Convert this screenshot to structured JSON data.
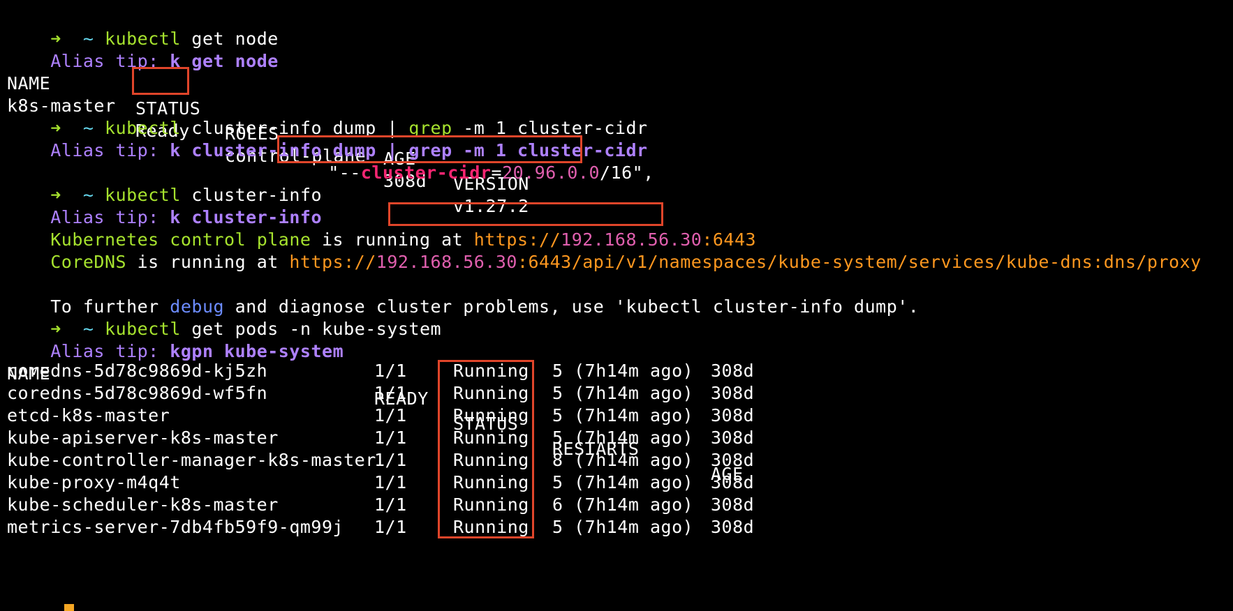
{
  "prompt": {
    "arrow": "➜",
    "tilde": "~"
  },
  "blocks": {
    "cmd1": {
      "kubectl": "kubectl",
      "rest": " get node"
    },
    "alias1": {
      "label": "Alias tip: ",
      "cmd": "k get node"
    },
    "node_table": {
      "headers": [
        "NAME",
        "STATUS",
        "ROLES",
        "AGE",
        "VERSION"
      ],
      "row": [
        "k8s-master",
        "Ready",
        "control-plane",
        "308d",
        "v1.27.2"
      ]
    },
    "cmd2": {
      "kubectl": "kubectl",
      "part1": " cluster-info dump | ",
      "grep": "grep",
      "part2": " -m 1 cluster-cidr"
    },
    "alias2": {
      "label": "Alias tip: ",
      "cmd": "k cluster-info dump | grep -m 1 cluster-cidr"
    },
    "cidr_line": {
      "prefix": "\"--",
      "flag": "cluster-cidr",
      "eq": "=",
      "ip": "20.96.0.0",
      "suffix": "/16\","
    },
    "cmd3": {
      "kubectl": "kubectl",
      "rest": " cluster-info"
    },
    "alias3": {
      "label": "Alias tip: ",
      "cmd": "k cluster-info"
    },
    "cp_line": {
      "name": "Kubernetes control plane",
      "mid": " is running at ",
      "url_pre": "https://",
      "url_ip": "192.168.56.30",
      "url_post": ":6443"
    },
    "dns_line": {
      "name": "CoreDNS",
      "mid": " is running at ",
      "url_pre": "https://",
      "url_ip": "192.168.56.30",
      "url_post": ":6443/api/v1/namespaces/kube-system/services/kube-dns:dns/proxy"
    },
    "debug_line": {
      "pre": "To further ",
      "debug": "debug",
      "post": " and diagnose cluster problems, use 'kubectl cluster-info dump'."
    },
    "cmd4": {
      "kubectl": "kubectl",
      "rest": " get pods -n kube-system"
    },
    "alias4": {
      "label": "Alias tip: ",
      "cmd": "kgpn kube-system"
    },
    "pods_table": {
      "headers": [
        "NAME",
        "READY",
        "STATUS",
        "RESTARTS",
        "AGE"
      ],
      "rows": [
        [
          "coredns-5d78c9869d-kj5zh",
          "1/1",
          "Running",
          "5 (7h14m ago)",
          "308d"
        ],
        [
          "coredns-5d78c9869d-wf5fn",
          "1/1",
          "Running",
          "5 (7h14m ago)",
          "308d"
        ],
        [
          "etcd-k8s-master",
          "1/1",
          "Running",
          "5 (7h14m ago)",
          "308d"
        ],
        [
          "kube-apiserver-k8s-master",
          "1/1",
          "Running",
          "5 (7h14m ago)",
          "308d"
        ],
        [
          "kube-controller-manager-k8s-master",
          "1/1",
          "Running",
          "8 (7h14m ago)",
          "308d"
        ],
        [
          "kube-proxy-m4q4t",
          "1/1",
          "Running",
          "5 (7h14m ago)",
          "308d"
        ],
        [
          "kube-scheduler-k8s-master",
          "1/1",
          "Running",
          "6 (7h14m ago)",
          "308d"
        ],
        [
          "metrics-server-7db4fb59f9-qm99j",
          "1/1",
          "Running",
          "5 (7h14m ago)",
          "308d"
        ]
      ]
    }
  },
  "colors": {
    "highlight": "#e0452a",
    "background": "#000000"
  }
}
